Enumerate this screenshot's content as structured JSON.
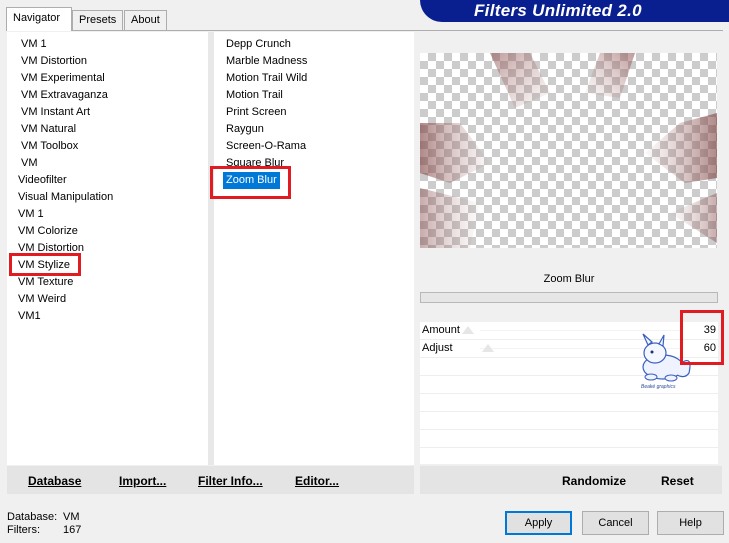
{
  "banner": {
    "title": "Filters Unlimited 2.0",
    "color": "#0a1f8f"
  },
  "tabs": [
    {
      "label": "Navigator",
      "active": true
    },
    {
      "label": "Presets",
      "active": false
    },
    {
      "label": "About",
      "active": false
    }
  ],
  "categories": [
    "VM 1",
    "VM Distortion",
    "VM Experimental",
    "VM Extravaganza",
    "VM Instant Art",
    "VM Natural",
    "VM Toolbox",
    "VM",
    "Videofilter",
    "Visual Manipulation",
    "VM 1",
    "VM Colorize",
    "VM Distortion",
    "VM Stylize",
    "VM Texture",
    "VM Weird",
    "VM1"
  ],
  "filters": [
    "Depp Crunch",
    "Marble Madness",
    "Motion Trail Wild",
    "Motion Trail",
    "Print Screen",
    "Raygun",
    "Screen-O-Rama",
    "Square Blur",
    "Zoom Blur"
  ],
  "selected_filter": "Zoom Blur",
  "preview": {
    "filter_name": "Zoom Blur"
  },
  "params": [
    {
      "label": "Amount",
      "value": "39",
      "fraction": 0.39
    },
    {
      "label": "Adjust",
      "value": "60",
      "fraction": 0.6
    }
  ],
  "left_buttons": {
    "database": "Database",
    "import": "Import...",
    "filter_info": "Filter Info...",
    "editor": "Editor..."
  },
  "right_buttons": {
    "randomize": "Randomize",
    "reset": "Reset"
  },
  "status": {
    "database_label": "Database:",
    "database_value": "VM",
    "filters_label": "Filters:",
    "filters_value": "167"
  },
  "dialog_buttons": {
    "apply": "Apply",
    "cancel": "Cancel",
    "help": "Help"
  },
  "watermark": "Beaké graphics",
  "highlight_color": "#e11b22",
  "selection_color": "#0078d7"
}
